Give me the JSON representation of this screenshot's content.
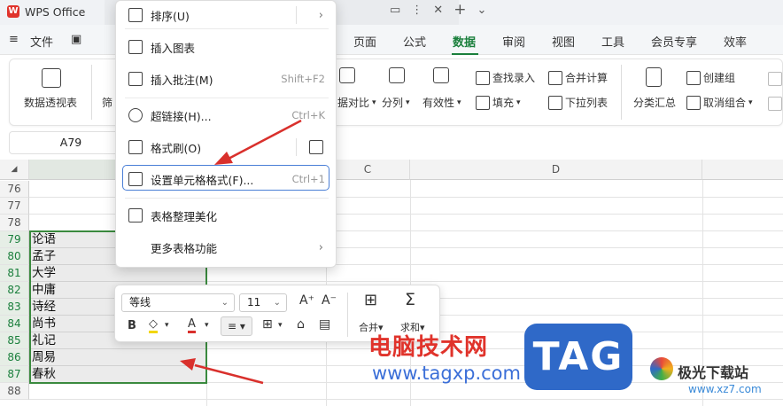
{
  "titlebar": {
    "app_name": "WPS Office"
  },
  "menu": {
    "file": "文件",
    "tabs": [
      "页面",
      "公式",
      "数据",
      "审阅",
      "视图",
      "工具",
      "会员专享",
      "效率"
    ],
    "active": "数据"
  },
  "ribbon": {
    "pivot": "数据透视表",
    "filter": "筛",
    "compare": "据对比",
    "split": "分列",
    "validity": "有效性",
    "lookup": "查找录入",
    "fill": "填充",
    "merge_calc": "合并计算",
    "dropdown_list": "下拉列表",
    "subtotal": "分类汇总",
    "create_group": "创建组",
    "ungroup": "取消组合"
  },
  "name_box": "A79",
  "columns": {
    "c": "C",
    "d": "D"
  },
  "rows": [
    "76",
    "77",
    "78",
    "79",
    "80",
    "81",
    "82",
    "83",
    "84",
    "85",
    "86",
    "87",
    "88"
  ],
  "cells": [
    "论语",
    "孟子",
    "大学",
    "中庸",
    "诗经",
    "尚书",
    "礼记",
    "周易",
    "春秋"
  ],
  "context_menu": {
    "items": [
      {
        "label": "排序(U)",
        "shortcut": "",
        "submenu": true
      },
      {
        "label": "插入图表",
        "shortcut": "",
        "submenu": false
      },
      {
        "label": "插入批注(M)",
        "shortcut": "Shift+F2",
        "submenu": false
      },
      {
        "label": "超链接(H)...",
        "shortcut": "Ctrl+K",
        "submenu": false
      },
      {
        "label": "格式刷(O)",
        "shortcut": "",
        "submenu": false
      },
      {
        "label": "设置单元格格式(F)...",
        "shortcut": "Ctrl+1",
        "submenu": false
      },
      {
        "label": "表格整理美化",
        "shortcut": "",
        "submenu": false
      },
      {
        "label": "更多表格功能",
        "shortcut": "",
        "submenu": true
      }
    ]
  },
  "mini_toolbar": {
    "font": "等线",
    "size": "11",
    "merge": "合并",
    "sum": "求和",
    "bold": "B"
  },
  "watermark": {
    "title": "电脑技术网",
    "url": "www.tagxp.com",
    "tag": "TAG",
    "site": "极光下载站",
    "site_url": "www.xz7.com"
  },
  "colors": {
    "accent": "#1a7f3c",
    "highlight": "#4a7fd6",
    "arrow": "#d9302c",
    "logo_red": "#e0332b"
  }
}
